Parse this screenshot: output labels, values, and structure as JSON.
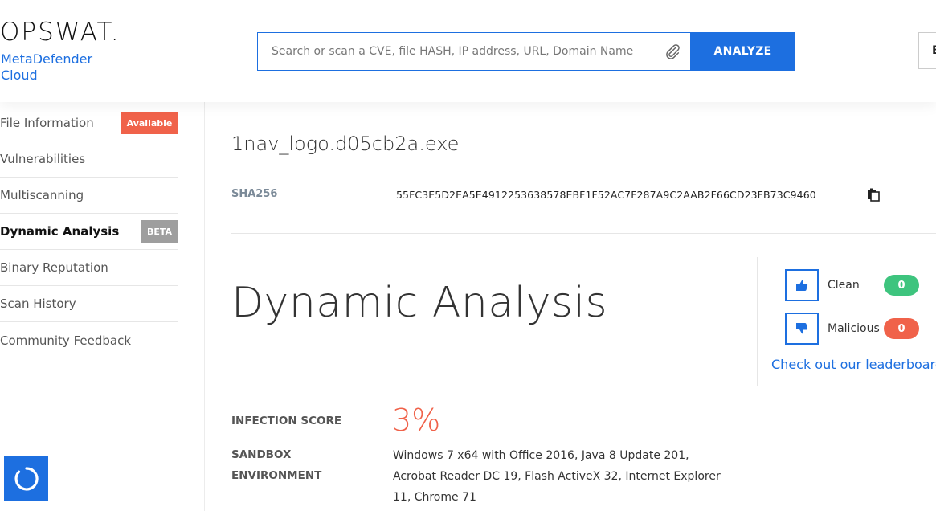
{
  "header": {
    "logo_text": "OPSWAT.",
    "product_line1": "MetaDefender",
    "product_line2": "Cloud",
    "search_placeholder": "Search or scan a CVE, file HASH, IP address, URL, Domain Name",
    "analyze_label": "ANALYZE",
    "right_button_label": "B"
  },
  "sidebar": {
    "items": [
      {
        "label": "File Information",
        "badge": "Available"
      },
      {
        "label": "Vulnerabilities",
        "badge": ""
      },
      {
        "label": "Multiscanning",
        "badge": ""
      },
      {
        "label": "Dynamic Analysis",
        "badge": "BETA"
      },
      {
        "label": "Binary Reputation",
        "badge": ""
      },
      {
        "label": "Scan History",
        "badge": ""
      },
      {
        "label": "Community Feedback",
        "badge": ""
      }
    ],
    "active_index": 3
  },
  "file": {
    "name": "1nav_logo.d05cb2a.exe",
    "sha_label": "SHA256",
    "sha_value": "55FC3E5D2EA5E4912253638578EBF1F52AC7F287A9C2AAB2F66CD23FB73C9460"
  },
  "section": {
    "title": "Dynamic Analysis"
  },
  "votes": {
    "clean_label": "Clean",
    "clean_count": "0",
    "malicious_label": "Malicious",
    "malicious_count": "0",
    "leaderboard_link": "Check out our leaderboard"
  },
  "details": {
    "infection_label": "INFECTION SCORE",
    "infection_value": "3%",
    "sandbox_label_line1": "SANDBOX",
    "sandbox_label_line2": "ENVIRONMENT",
    "sandbox_value": "Windows 7 x64 with Office 2016, Java 8 Update 201, Acrobat Reader DC 19, Flash ActiveX 32, Internet Explorer 11, Chrome 71"
  },
  "colors": {
    "accent": "#1d6fe0",
    "available_badge": "#f0624a",
    "beta_badge": "#9e9e9e",
    "clean_badge": "#3ec47e",
    "malicious_badge": "#f0624a"
  },
  "icons": {
    "attach": "paperclip-icon",
    "copy": "clipboard-copy-icon",
    "thumb_up": "thumbs-up-icon",
    "thumb_down": "thumbs-down-icon",
    "chat": "chat-ring-icon"
  }
}
